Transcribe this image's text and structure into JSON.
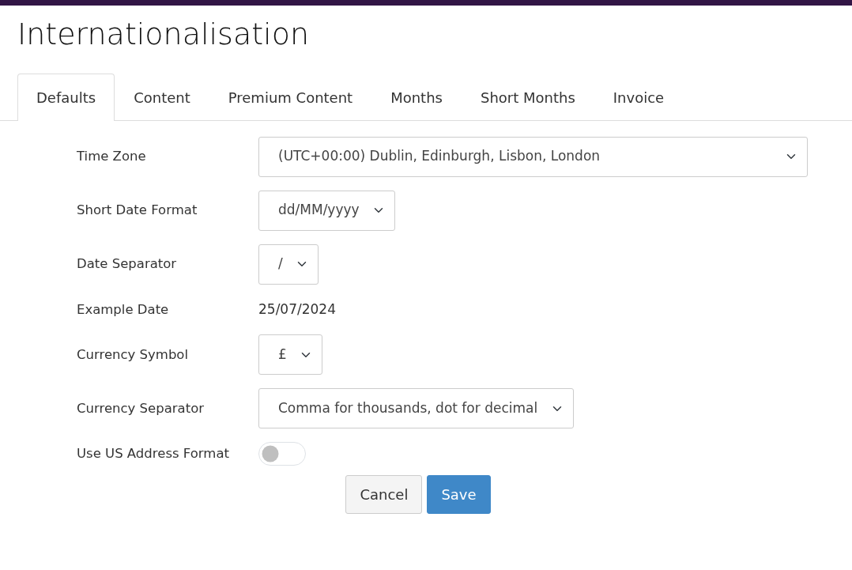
{
  "page": {
    "title": "Internationalisation"
  },
  "tabs": [
    {
      "label": "Defaults",
      "selected": true
    },
    {
      "label": "Content",
      "selected": false
    },
    {
      "label": "Premium Content",
      "selected": false
    },
    {
      "label": "Months",
      "selected": false
    },
    {
      "label": "Short Months",
      "selected": false
    },
    {
      "label": "Invoice",
      "selected": false
    }
  ],
  "fields": [
    {
      "kind": "select",
      "label": "Time Zone",
      "value": "(UTC+00:00) Dublin, Edinburgh, Lisbon, London"
    },
    {
      "kind": "select",
      "label": "Short Date Format",
      "value": "dd/MM/yyyy"
    },
    {
      "kind": "select",
      "label": "Date Separator",
      "value": "/"
    },
    {
      "kind": "text",
      "label": "Example Date",
      "value": "25/07/2024"
    },
    {
      "kind": "select",
      "label": "Currency Symbol",
      "value": "£"
    },
    {
      "kind": "select",
      "label": "Currency Separator",
      "value": "Comma for thousands, dot for decimal"
    },
    {
      "kind": "toggle",
      "label": "Use US Address Format",
      "on": false
    }
  ],
  "buttons": [
    {
      "label": "Cancel",
      "kind": "secondary"
    },
    {
      "label": "Save",
      "kind": "primary"
    }
  ]
}
